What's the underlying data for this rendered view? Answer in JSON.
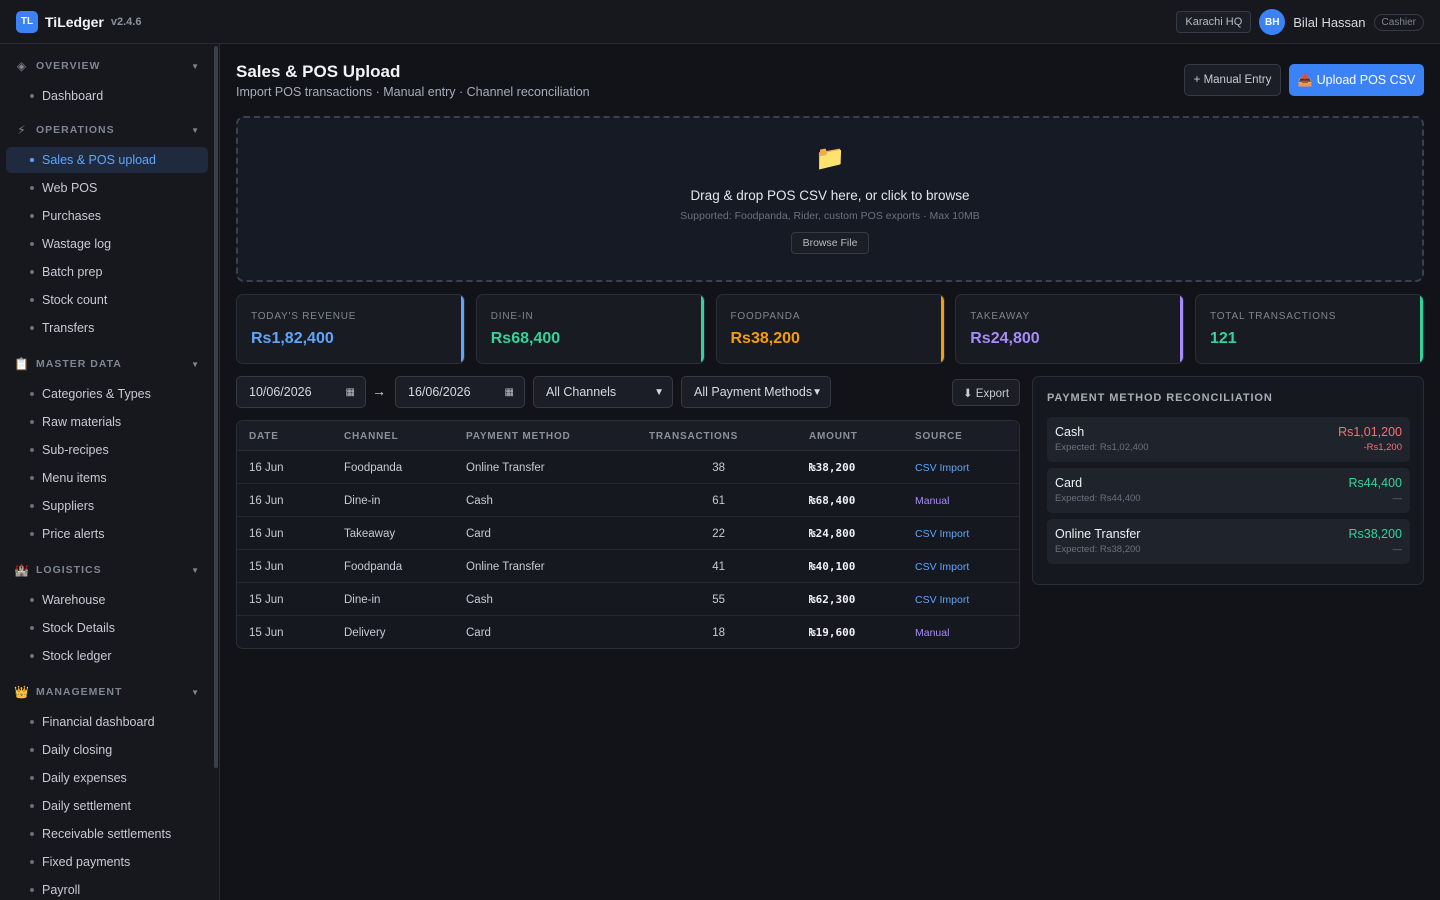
{
  "app": {
    "logo": "TL",
    "name": "TiLedger",
    "version": "v2.4.6"
  },
  "header": {
    "branch": "Karachi HQ",
    "user_initials": "BH",
    "user_name": "Bilal Hassan",
    "user_role": "Cashier"
  },
  "sidebar": {
    "sections": [
      {
        "title": "OVERVIEW",
        "icon": "◈",
        "items": [
          "Dashboard"
        ]
      },
      {
        "title": "OPERATIONS",
        "icon": "⚡",
        "items": [
          "Sales & POS upload",
          "Web POS",
          "Purchases",
          "Wastage log",
          "Batch prep",
          "Stock count",
          "Transfers"
        ]
      },
      {
        "title": "MASTER DATA",
        "icon": "📋",
        "items": [
          "Categories & Types",
          "Raw materials",
          "Sub-recipes",
          "Menu items",
          "Suppliers",
          "Price alerts"
        ]
      },
      {
        "title": "LOGISTICS",
        "icon": "🏰",
        "items": [
          "Warehouse",
          "Stock Details",
          "Stock ledger"
        ]
      },
      {
        "title": "MANAGEMENT",
        "icon": "👑",
        "items": [
          "Financial dashboard",
          "Daily closing",
          "Daily expenses",
          "Daily settlement",
          "Receivable settlements",
          "Fixed payments",
          "Payroll"
        ]
      }
    ],
    "active": "Sales & POS upload"
  },
  "page": {
    "title": "Sales & POS Upload",
    "subtitle": "Import POS transactions · Manual entry · Channel reconciliation",
    "manual_entry_label": "+ Manual Entry",
    "upload_label": "Upload POS CSV",
    "upload_icon": "📥"
  },
  "dropzone": {
    "icon": "📁",
    "title": "Drag & drop POS CSV here, or click to browse",
    "subtitle": "Supported: Foodpanda, Rider, custom POS exports · Max 10MB",
    "browse_label": "Browse File"
  },
  "stats": [
    {
      "label": "TODAY'S REVENUE",
      "value": "Rs1,82,400",
      "color": "#60a5fa"
    },
    {
      "label": "DINE-IN",
      "value": "Rs68,400",
      "color": "#34d399"
    },
    {
      "label": "FOODPANDA",
      "value": "Rs38,200",
      "color": "#f59e0b"
    },
    {
      "label": "TAKEAWAY",
      "value": "Rs24,800",
      "color": "#a78bfa"
    },
    {
      "label": "TOTAL TRANSACTIONS",
      "value": "121",
      "color": "#34d399"
    }
  ],
  "filters": {
    "date_from": "10/06/2026",
    "date_to": "16/06/2026",
    "arrow": "→",
    "channel": "All Channels",
    "payment": "All Payment Methods",
    "export_label": "⬇ Export"
  },
  "table": {
    "columns": [
      "DATE",
      "CHANNEL",
      "PAYMENT METHOD",
      "TRANSACTIONS",
      "AMOUNT",
      "SOURCE"
    ],
    "rows": [
      {
        "date": "16 Jun",
        "channel": "Foodpanda",
        "payment": "Online Transfer",
        "transactions": "38",
        "amount": "₨38,200",
        "source": "CSV Import"
      },
      {
        "date": "16 Jun",
        "channel": "Dine-in",
        "payment": "Cash",
        "transactions": "61",
        "amount": "₨68,400",
        "source": "Manual"
      },
      {
        "date": "16 Jun",
        "channel": "Takeaway",
        "payment": "Card",
        "transactions": "22",
        "amount": "₨24,800",
        "source": "CSV Import"
      },
      {
        "date": "15 Jun",
        "channel": "Foodpanda",
        "payment": "Online Transfer",
        "transactions": "41",
        "amount": "₨40,100",
        "source": "CSV Import"
      },
      {
        "date": "15 Jun",
        "channel": "Dine-in",
        "payment": "Cash",
        "transactions": "55",
        "amount": "₨62,300",
        "source": "CSV Import"
      },
      {
        "date": "15 Jun",
        "channel": "Delivery",
        "payment": "Card",
        "transactions": "18",
        "amount": "₨19,600",
        "source": "Manual"
      }
    ],
    "source_colors": {
      "CSV Import": "#60a5fa",
      "Manual": "#a78bfa"
    }
  },
  "reconciliation": {
    "title": "PAYMENT METHOD RECONCILIATION",
    "rows": [
      {
        "name": "Cash",
        "expected": "Expected: Rs1,02,400",
        "actual": "Rs1,01,200",
        "diff": "-Rs1,200",
        "color": "#f87171"
      },
      {
        "name": "Card",
        "expected": "Expected: Rs44,400",
        "actual": "Rs44,400",
        "diff": "—",
        "color": "#34d399"
      },
      {
        "name": "Online Transfer",
        "expected": "Expected: Rs38,200",
        "actual": "Rs38,200",
        "diff": "—",
        "color": "#34d399"
      }
    ]
  }
}
